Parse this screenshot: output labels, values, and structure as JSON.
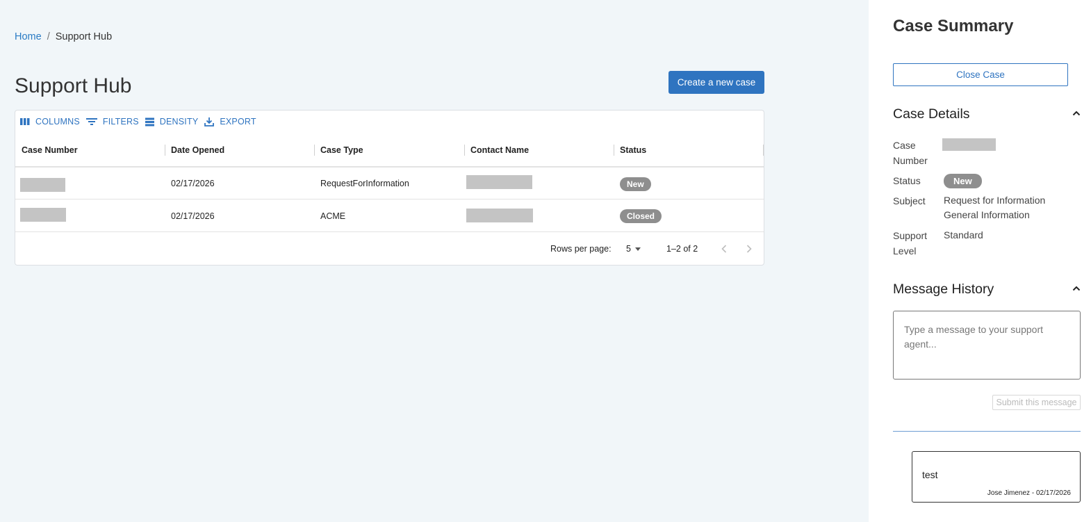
{
  "breadcrumb": {
    "home": "Home",
    "separator": "/",
    "current": "Support Hub"
  },
  "page": {
    "title": "Support Hub",
    "create_button": "Create a new case"
  },
  "toolbar": {
    "columns": "COLUMNS",
    "filters": "FILTERS",
    "density": "DENSITY",
    "export": "EXPORT"
  },
  "table": {
    "headers": [
      "Case Number",
      "Date Opened",
      "Case Type",
      "Contact Name",
      "Status"
    ],
    "rows": [
      {
        "date_opened": "02/17/2026",
        "case_type": "RequestForInformation",
        "status": "New"
      },
      {
        "date_opened": "02/17/2026",
        "case_type": "ACME",
        "status": "Closed"
      }
    ]
  },
  "pagination": {
    "rows_per_page_label": "Rows per page:",
    "rows_per_page": "5",
    "range": "1–2 of 2"
  },
  "panel": {
    "title": "Case Summary",
    "close_button": "Close Case",
    "details_title": "Case Details",
    "labels": {
      "case_number": "Case Number",
      "status": "Status",
      "subject": "Subject",
      "support_level": "Support Level"
    },
    "status": "New",
    "subject_line1": "Request for Information",
    "subject_line2": "General Information",
    "support_level": "Standard",
    "history_title": "Message History",
    "message_placeholder": "Type a message to your support agent...",
    "submit_button": "Submit this message",
    "messages": [
      {
        "text": "test",
        "meta": "Jose Jimenez - 02/17/2026"
      }
    ]
  },
  "colors": {
    "accent": "#2f74c0",
    "badge": "#8e8e8e",
    "background": "#f1f6f9"
  }
}
